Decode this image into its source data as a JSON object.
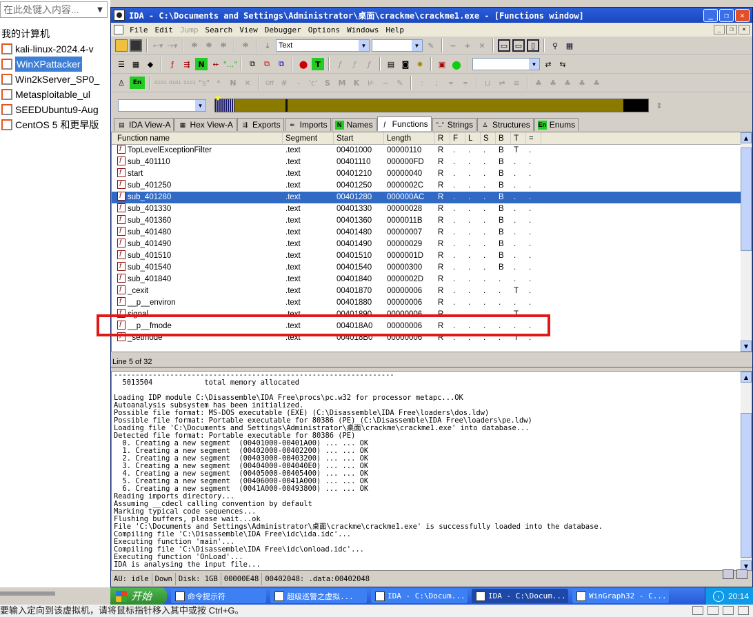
{
  "vmware": {
    "search_placeholder": "在此处键入内容...",
    "tree_root": "我的计算机",
    "vms": [
      {
        "label": "kali-linux-2024.4-v"
      },
      {
        "label": "WinXPattacker",
        "selected": true
      },
      {
        "label": "Win2kServer_SP0_"
      },
      {
        "label": "Metasploitable_ul"
      },
      {
        "label": "SEEDUbuntu9-Aug"
      },
      {
        "label": "CentOS 5 和更早版"
      }
    ],
    "bottom_status": "要输入定向到该虚拟机，请将鼠标指针移入其中或按 Ctrl+G。"
  },
  "ida": {
    "title": "IDA - C:\\Documents and Settings\\Administrator\\桌面\\crackme\\crackme1.exe - [Functions window]",
    "menu": [
      "File",
      "Edit",
      "Jump",
      "Search",
      "View",
      "Debugger",
      "Options",
      "Windows",
      "Help"
    ],
    "disabled_menu": [
      "Jump"
    ],
    "toolbar_combo_text": "Text",
    "tabs": [
      {
        "label": "IDA View-A"
      },
      {
        "label": "Hex View-A"
      },
      {
        "label": "Exports"
      },
      {
        "label": "Imports"
      },
      {
        "label": "Names"
      },
      {
        "label": "Functions",
        "active": true
      },
      {
        "label": "Strings"
      },
      {
        "label": "Structures"
      },
      {
        "label": "Enums"
      }
    ],
    "functions": {
      "columns": [
        "Function name",
        "Segment",
        "Start",
        "Length",
        "R",
        "F",
        "L",
        "S",
        "B",
        "T",
        "="
      ],
      "rows": [
        [
          "TopLevelExceptionFilter",
          ".text",
          "00401000",
          "00000110",
          "R",
          ".",
          ".",
          ".",
          "B",
          "T",
          "."
        ],
        [
          "sub_401110",
          ".text",
          "00401110",
          "000000FD",
          "R",
          ".",
          ".",
          ".",
          "B",
          ".",
          "."
        ],
        [
          "start",
          ".text",
          "00401210",
          "00000040",
          "R",
          ".",
          ".",
          ".",
          "B",
          ".",
          "."
        ],
        [
          "sub_401250",
          ".text",
          "00401250",
          "0000002C",
          "R",
          ".",
          ".",
          ".",
          "B",
          ".",
          "."
        ],
        [
          "sub_401280",
          ".text",
          "00401280",
          "000000AC",
          "R",
          ".",
          ".",
          ".",
          "B",
          ".",
          "."
        ],
        [
          "sub_401330",
          ".text",
          "00401330",
          "00000028",
          "R",
          ".",
          ".",
          ".",
          "B",
          ".",
          "."
        ],
        [
          "sub_401360",
          ".text",
          "00401360",
          "0000011B",
          "R",
          ".",
          ".",
          ".",
          "B",
          ".",
          "."
        ],
        [
          "sub_401480",
          ".text",
          "00401480",
          "00000007",
          "R",
          ".",
          ".",
          ".",
          "B",
          ".",
          "."
        ],
        [
          "sub_401490",
          ".text",
          "00401490",
          "00000029",
          "R",
          ".",
          ".",
          ".",
          "B",
          ".",
          "."
        ],
        [
          "sub_401510",
          ".text",
          "00401510",
          "0000001D",
          "R",
          ".",
          ".",
          ".",
          "B",
          ".",
          "."
        ],
        [
          "sub_401540",
          ".text",
          "00401540",
          "00000300",
          "R",
          ".",
          ".",
          ".",
          "B",
          ".",
          "."
        ],
        [
          "sub_401840",
          ".text",
          "00401840",
          "0000002D",
          "R",
          ".",
          ".",
          ".",
          ".",
          ".",
          "."
        ],
        [
          "_cexit",
          ".text",
          "00401870",
          "00000006",
          "R",
          ".",
          ".",
          ".",
          ".",
          "T",
          "."
        ],
        [
          "__p__environ",
          ".text",
          "00401880",
          "00000006",
          "R",
          ".",
          ".",
          ".",
          ".",
          ".",
          "."
        ],
        [
          "signal",
          ".text",
          "00401890",
          "00000006",
          "R",
          ".",
          ".",
          ".",
          ".",
          "T",
          "."
        ],
        [
          "__p__fmode",
          ".text",
          "004018A0",
          "00000006",
          "R",
          ".",
          ".",
          ".",
          ".",
          ".",
          "."
        ],
        [
          "_setmode",
          ".text",
          "004018B0",
          "00000006",
          "R",
          ".",
          ".",
          ".",
          ".",
          "T",
          "."
        ]
      ],
      "selected_index": 4,
      "line_info": "Line 5 of 32"
    },
    "log": [
      "-----------------------------------------------------------------",
      "  5013504            total memory allocated",
      "",
      "Loading IDP module C:\\Disassemble\\IDA Free\\procs\\pc.w32 for processor metapc...OK",
      "Autoanalysis subsystem has been initialized.",
      "Possible file format: MS-DOS executable (EXE) (C:\\Disassemble\\IDA Free\\loaders\\dos.ldw)",
      "Possible file format: Portable executable for 80386 (PE) (C:\\Disassemble\\IDA Free\\loaders\\pe.ldw)",
      "Loading file 'C:\\Documents and Settings\\Administrator\\桌面\\crackme\\crackme1.exe' into database...",
      "Detected file format: Portable executable for 80386 (PE)",
      "  0. Creating a new segment  (00401000-00401A00) ... ... OK",
      "  1. Creating a new segment  (00402000-00402200) ... ... OK",
      "  2. Creating a new segment  (00403000-00403200) ... ... OK",
      "  3. Creating a new segment  (00404000-004040E0) ... ... OK",
      "  4. Creating a new segment  (00405000-00405400) ... ... OK",
      "  5. Creating a new segment  (00406000-0041A000) ... ... OK",
      "  6. Creating a new segment  (0041A000-00493800) ... ... OK",
      "Reading imports directory...",
      "Assuming __cdecl calling convention by default",
      "Marking typical code sequences...",
      "Flushing buffers, please wait...ok",
      "File 'C:\\Documents and Settings\\Administrator\\桌面\\crackme\\crackme1.exe' is successfully loaded into the database.",
      "Compiling file 'C:\\Disassemble\\IDA Free\\idc\\ida.idc'...",
      "Executing function 'main'...",
      "Compiling file 'C:\\Disassemble\\IDA Free\\idc\\onload.idc'...",
      "Executing function 'OnLoad'...",
      "IDA is analysing the input file..."
    ],
    "status": {
      "au": "AU:  idle",
      "dir": "Down",
      "disk": "Disk: 1GB",
      "size": "00000E48",
      "addr": "00402048: .data:00402048"
    }
  },
  "taskbar": {
    "start": "开始",
    "tasks": [
      {
        "label": "命令提示符"
      },
      {
        "label": "超级巡警之虚拟..."
      },
      {
        "label": "IDA - C:\\Docum..."
      },
      {
        "label": "IDA - C:\\Docum...",
        "active": true
      },
      {
        "label": "WinGraph32 - C..."
      }
    ],
    "clock": "20:14"
  },
  "colors": {
    "selection": "#316ac5",
    "highlight_box": "#e01818",
    "title_blue": "#2a5ed8"
  }
}
